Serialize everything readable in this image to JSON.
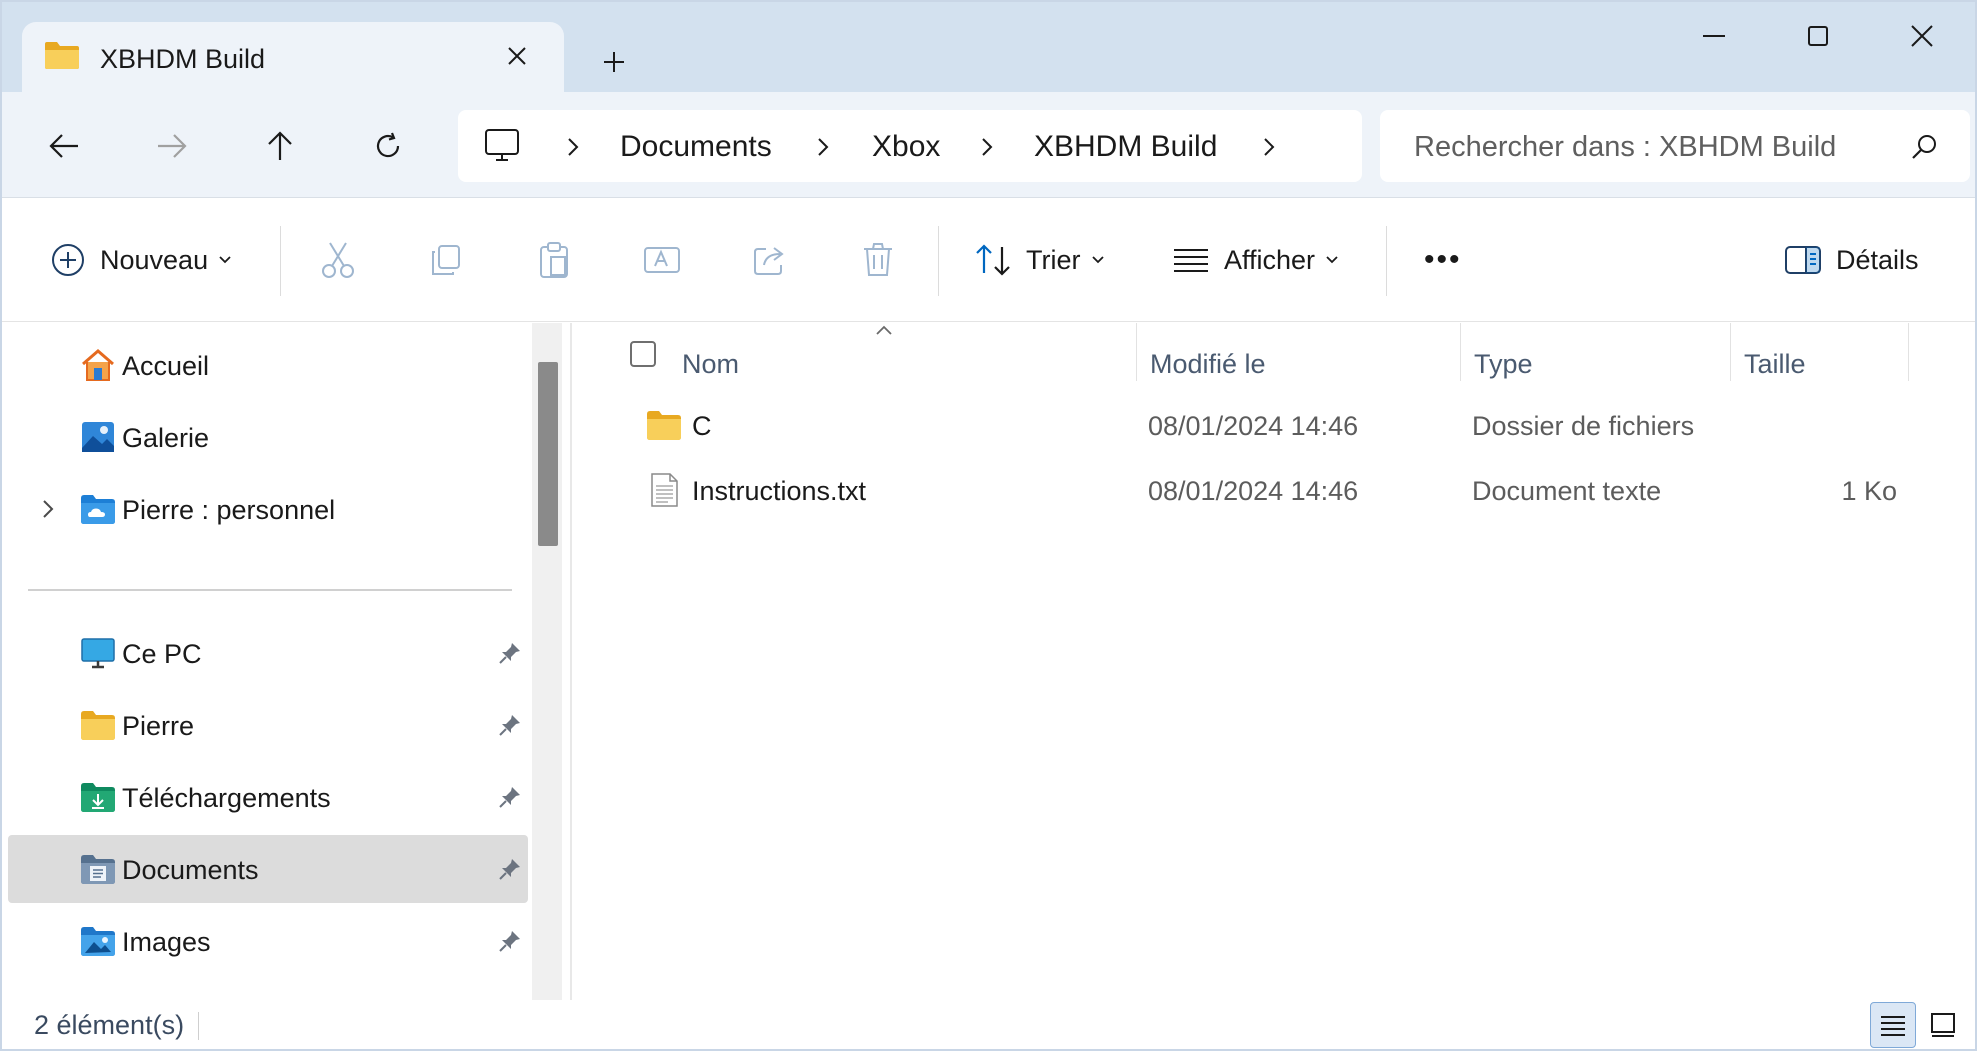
{
  "window": {
    "tab_title": "XBHDM Build"
  },
  "navigation": {
    "breadcrumbs": [
      "Documents",
      "Xbox",
      "XBHDM Build"
    ],
    "search_placeholder": "Rechercher dans : XBHDM Build"
  },
  "toolbar": {
    "new_label": "Nouveau",
    "sort_label": "Trier",
    "view_label": "Afficher",
    "more_label": "•••",
    "details_label": "Détails"
  },
  "sidebar": {
    "top_items": [
      {
        "label": "Accueil",
        "icon": "home-icon"
      },
      {
        "label": "Galerie",
        "icon": "gallery-icon"
      },
      {
        "label": "Pierre : personnel",
        "icon": "onedrive-folder-icon"
      }
    ],
    "pinned_items": [
      {
        "label": "Ce PC",
        "icon": "pc-icon"
      },
      {
        "label": "Pierre",
        "icon": "folder-icon"
      },
      {
        "label": "Téléchargements",
        "icon": "downloads-icon"
      },
      {
        "label": "Documents",
        "icon": "documents-icon",
        "selected": true
      },
      {
        "label": "Images",
        "icon": "images-icon"
      }
    ]
  },
  "file_list": {
    "columns": [
      "Nom",
      "Modifié le",
      "Type",
      "Taille"
    ],
    "rows": [
      {
        "name": "C",
        "modified": "08/01/2024 14:46",
        "type": "Dossier de fichiers",
        "size": "",
        "icon": "folder-icon"
      },
      {
        "name": "Instructions.txt",
        "modified": "08/01/2024 14:46",
        "type": "Document texte",
        "size": "1 Ko",
        "icon": "text-file-icon"
      }
    ]
  },
  "status": {
    "item_count": "2 élément(s)"
  },
  "colors": {
    "titlebar": "#d3e1ef",
    "navrow": "#eef3f9",
    "accent": "#0067c0",
    "folder": "#f5c542",
    "selected": "#dcdcdc"
  }
}
